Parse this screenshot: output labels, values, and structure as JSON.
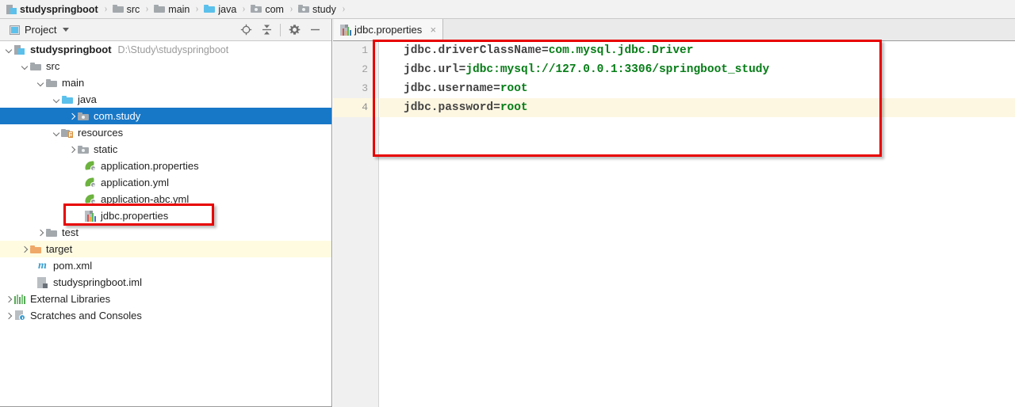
{
  "breadcrumb": {
    "separator": "›",
    "items": [
      {
        "label": "studyspringboot",
        "icon": "module-icon",
        "bold": true
      },
      {
        "label": "src",
        "icon": "folder-gray-icon",
        "bold": false
      },
      {
        "label": "main",
        "icon": "folder-gray-icon",
        "bold": false
      },
      {
        "label": "java",
        "icon": "folder-blue-icon",
        "bold": false
      },
      {
        "label": "com",
        "icon": "package-icon",
        "bold": false
      },
      {
        "label": "study",
        "icon": "package-icon",
        "bold": false
      }
    ]
  },
  "project_panel": {
    "title": "Project",
    "title_icon": "project-window-icon",
    "dropdown_icon": "chevron-down-icon",
    "actions": [
      {
        "name": "locate-icon",
        "label": "Select Opened File"
      },
      {
        "name": "collapse-all-icon",
        "label": "Collapse All"
      },
      {
        "name": "gear-icon",
        "label": "Settings"
      },
      {
        "name": "minimize-icon",
        "label": "Hide"
      }
    ],
    "tree": [
      {
        "label": "studyspringboot",
        "sub": "D:\\Study\\studyspringboot",
        "icon": "module-icon",
        "arrow": "down",
        "indent": 0,
        "bold": true,
        "state": "normal"
      },
      {
        "label": "src",
        "sub": "",
        "icon": "folder-gray-icon",
        "arrow": "down",
        "indent": 1,
        "bold": false,
        "state": "normal"
      },
      {
        "label": "main",
        "sub": "",
        "icon": "folder-gray-icon",
        "arrow": "down",
        "indent": 2,
        "bold": false,
        "state": "normal"
      },
      {
        "label": "java",
        "sub": "",
        "icon": "folder-blue-icon",
        "arrow": "down",
        "indent": 3,
        "bold": false,
        "state": "normal"
      },
      {
        "label": "com.study",
        "sub": "",
        "icon": "package-icon",
        "arrow": "right",
        "indent": 4,
        "bold": false,
        "state": "selected"
      },
      {
        "label": "resources",
        "sub": "",
        "icon": "resources-icon",
        "arrow": "down",
        "indent": 3,
        "bold": false,
        "state": "normal"
      },
      {
        "label": "static",
        "sub": "",
        "icon": "package-icon",
        "arrow": "right",
        "indent": 4,
        "bold": false,
        "state": "normal"
      },
      {
        "label": "application.properties",
        "sub": "",
        "icon": "spring-leaf-icon",
        "arrow": "none",
        "indent": 5,
        "bold": false,
        "state": "normal"
      },
      {
        "label": "application.yml",
        "sub": "",
        "icon": "spring-leaf-icon",
        "arrow": "none",
        "indent": 5,
        "bold": false,
        "state": "normal"
      },
      {
        "label": "application-abc.yml",
        "sub": "",
        "icon": "spring-leaf-icon",
        "arrow": "none",
        "indent": 5,
        "bold": false,
        "state": "normal"
      },
      {
        "label": "jdbc.properties",
        "sub": "",
        "icon": "properties-file-icon",
        "arrow": "none",
        "indent": 5,
        "bold": false,
        "state": "normal"
      },
      {
        "label": "test",
        "sub": "",
        "icon": "folder-gray-icon",
        "arrow": "right",
        "indent": 2,
        "bold": false,
        "state": "normal"
      },
      {
        "label": "target",
        "sub": "",
        "icon": "folder-orange-icon",
        "arrow": "right",
        "indent": 1,
        "bold": false,
        "state": "highlight"
      },
      {
        "label": "pom.xml",
        "sub": "",
        "icon": "maven-icon",
        "arrow": "none",
        "indent": 2,
        "bold": false,
        "state": "normal"
      },
      {
        "label": "studyspringboot.iml",
        "sub": "",
        "icon": "iml-file-icon",
        "arrow": "none",
        "indent": 2,
        "bold": false,
        "state": "normal"
      },
      {
        "label": "External Libraries",
        "sub": "",
        "icon": "libraries-icon",
        "arrow": "right",
        "indent": 0,
        "bold": false,
        "state": "normal"
      },
      {
        "label": "Scratches and Consoles",
        "sub": "",
        "icon": "scratches-icon",
        "arrow": "right",
        "indent": 0,
        "bold": false,
        "state": "normal"
      }
    ]
  },
  "editor": {
    "tab": {
      "label": "jdbc.properties",
      "icon": "properties-file-icon",
      "close_icon": "close-icon",
      "close_glyph": "×"
    },
    "line_numbers": [
      "1",
      "2",
      "3",
      "4"
    ],
    "current_line": 4,
    "lines": [
      {
        "key": "jdbc.driverClassName=",
        "value": "com.mysql.jdbc.Driver"
      },
      {
        "key": "jdbc.url=",
        "value": "jdbc:mysql://127.0.0.1:3306/springboot_study"
      },
      {
        "key": "jdbc.username=",
        "value": "root"
      },
      {
        "key": "jdbc.password=",
        "value": "root"
      }
    ]
  },
  "annotations": {
    "tree_highlight": {
      "name": "red-highlight-jdbc-properties"
    },
    "editor_highlight": {
      "name": "red-highlight-code-block"
    },
    "color": "#e80000"
  },
  "colors": {
    "selection": "#1878c8",
    "current_line": "#fdf7e2",
    "value_text": "#067d17",
    "key_text": "#444444",
    "annotation": "#e80000"
  }
}
